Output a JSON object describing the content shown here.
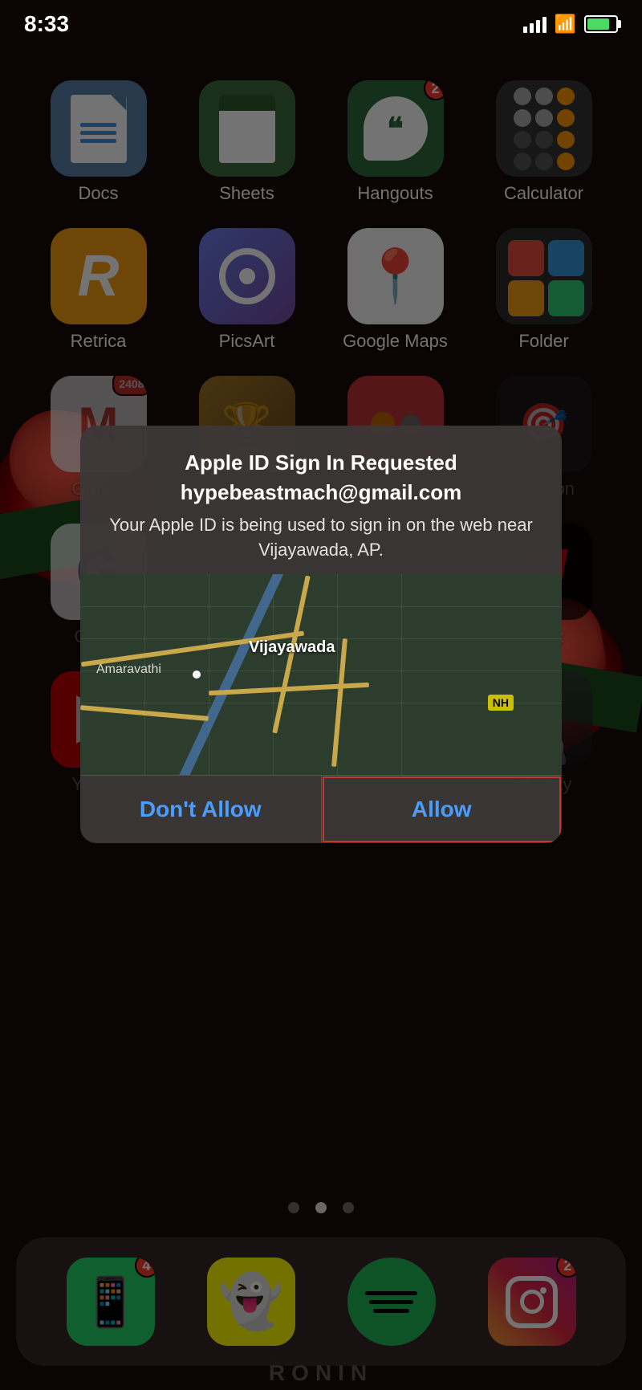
{
  "statusBar": {
    "time": "8:33",
    "signal": "signal-bars",
    "wifi": "wifi",
    "battery": "charging"
  },
  "appGrid": {
    "row1": [
      {
        "name": "Docs",
        "icon": "docs",
        "badge": null
      },
      {
        "name": "Sheets",
        "icon": "sheets",
        "badge": null
      },
      {
        "name": "Hangouts",
        "icon": "hangouts",
        "badge": "2"
      },
      {
        "name": "Calculator",
        "icon": "calculator",
        "badge": null
      }
    ],
    "row2": [
      {
        "name": "Retrica",
        "icon": "retrica",
        "badge": null
      },
      {
        "name": "PicsArt",
        "icon": "picsart",
        "badge": null
      },
      {
        "name": "Google Maps",
        "icon": "maps",
        "badge": null
      },
      {
        "name": "Folder",
        "icon": "folder",
        "badge": null
      }
    ],
    "row3": [
      {
        "name": "Gmail",
        "icon": "gmail",
        "badge": "2408"
      },
      {
        "name": "",
        "icon": "misc1",
        "badge": null
      },
      {
        "name": "",
        "icon": "misc2",
        "badge": null
      },
      {
        "name": "",
        "icon": "misc3",
        "badge": null
      }
    ],
    "row4": [
      {
        "name": "Google",
        "icon": "google",
        "badge": null
      },
      {
        "name": "",
        "icon": "blank",
        "badge": null
      },
      {
        "name": "",
        "icon": "blank",
        "badge": null
      },
      {
        "name": "Netflix",
        "icon": "netflix",
        "badge": null
      }
    ],
    "row5": [
      {
        "name": "YouTube",
        "icon": "youtube",
        "badge": null
      },
      {
        "name": "",
        "icon": "blank",
        "badge": null
      },
      {
        "name": "",
        "icon": "blank",
        "badge": null
      },
      {
        "name": "Call of Duty",
        "icon": "cod",
        "badge": null
      }
    ]
  },
  "alert": {
    "title": "Apple ID Sign In Requested",
    "email": "hypebeastmach@gmail.com",
    "body": "Your Apple ID is being used to sign in on the web near Vijayawada, AP.",
    "mapLabel": "Vijayawada",
    "mapLabelSm": "Amaravathi",
    "nhBadge": "NH",
    "btnDontAllow": "Don't Allow",
    "btnAllow": "Allow"
  },
  "pageDots": {
    "dots": [
      "inactive",
      "active",
      "inactive"
    ]
  },
  "dock": {
    "apps": [
      {
        "name": "WhatsApp",
        "icon": "whatsapp",
        "badge": "4"
      },
      {
        "name": "Snapchat",
        "icon": "snapchat",
        "badge": null
      },
      {
        "name": "Spotify",
        "icon": "spotify",
        "badge": null
      },
      {
        "name": "Instagram",
        "icon": "instagram",
        "badge": "2"
      }
    ]
  },
  "bottomText": "RONIN"
}
